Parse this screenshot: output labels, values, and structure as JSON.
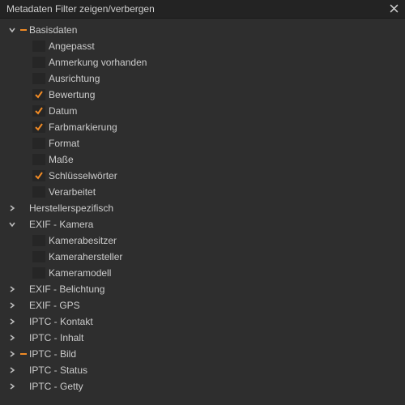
{
  "panel": {
    "title": "Metadaten Filter zeigen/verbergen"
  },
  "groups": [
    {
      "id": "basisdaten",
      "label": "Basisdaten",
      "expanded": true,
      "state": "partial",
      "items": [
        {
          "label": "Angepasst",
          "checked": false
        },
        {
          "label": "Anmerkung vorhanden",
          "checked": false
        },
        {
          "label": "Ausrichtung",
          "checked": false
        },
        {
          "label": "Bewertung",
          "checked": true
        },
        {
          "label": "Datum",
          "checked": true
        },
        {
          "label": "Farbmarkierung",
          "checked": true
        },
        {
          "label": "Format",
          "checked": false
        },
        {
          "label": "Maße",
          "checked": false
        },
        {
          "label": "Schlüsselwörter",
          "checked": true
        },
        {
          "label": "Verarbeitet",
          "checked": false
        }
      ]
    },
    {
      "id": "herstellerspezifisch",
      "label": "Herstellerspezifisch",
      "expanded": false,
      "state": "none",
      "items": []
    },
    {
      "id": "exif-kamera",
      "label": "EXIF - Kamera",
      "expanded": true,
      "state": "none",
      "items": [
        {
          "label": "Kamerabesitzer",
          "checked": false
        },
        {
          "label": "Kamerahersteller",
          "checked": false
        },
        {
          "label": "Kameramodell",
          "checked": false
        }
      ]
    },
    {
      "id": "exif-belichtung",
      "label": "EXIF - Belichtung",
      "expanded": false,
      "state": "none",
      "items": []
    },
    {
      "id": "exif-gps",
      "label": "EXIF - GPS",
      "expanded": false,
      "state": "none",
      "items": []
    },
    {
      "id": "iptc-kontakt",
      "label": "IPTC - Kontakt",
      "expanded": false,
      "state": "none",
      "items": []
    },
    {
      "id": "iptc-inhalt",
      "label": "IPTC - Inhalt",
      "expanded": false,
      "state": "none",
      "items": []
    },
    {
      "id": "iptc-bild",
      "label": "IPTC - Bild",
      "expanded": false,
      "state": "partial",
      "items": []
    },
    {
      "id": "iptc-status",
      "label": "IPTC - Status",
      "expanded": false,
      "state": "none",
      "items": []
    },
    {
      "id": "iptc-getty",
      "label": "IPTC - Getty",
      "expanded": false,
      "state": "none",
      "items": []
    }
  ],
  "colors": {
    "accent": "#f08a24"
  }
}
